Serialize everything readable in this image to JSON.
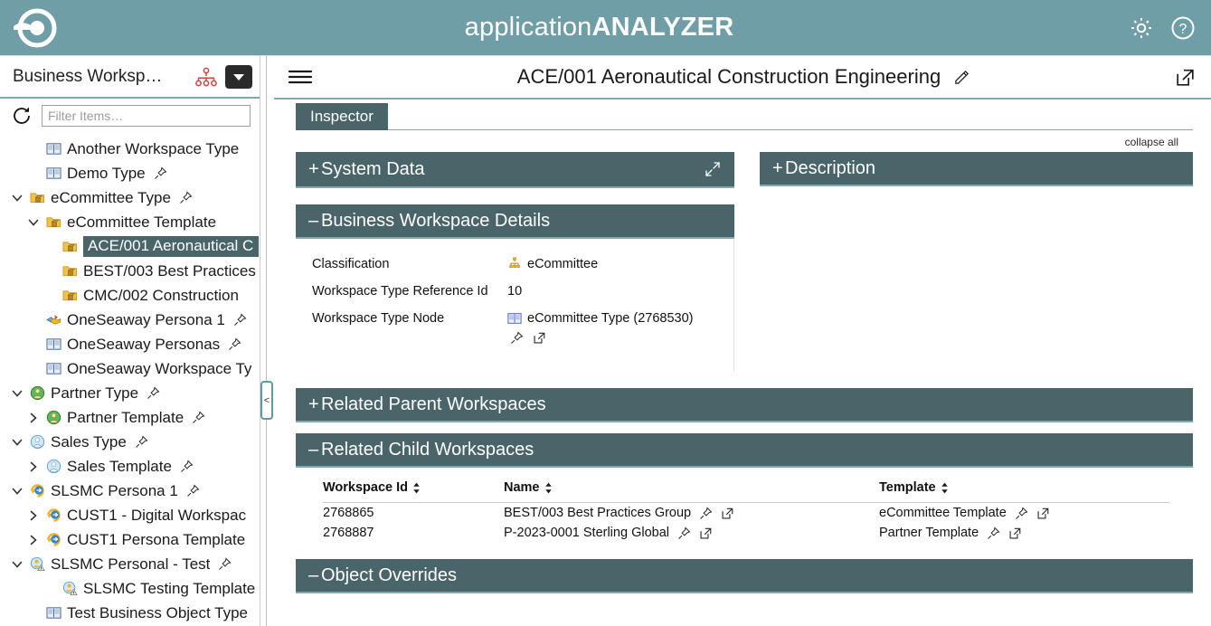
{
  "app": {
    "brand_light": "application",
    "brand_bold": "ANALYZER",
    "logo_icon": "target-ring-logo",
    "settings_icon": "gear-icon",
    "help_icon": "question-circle-icon"
  },
  "sidebar": {
    "title": "Business Worksp…",
    "hierarchy_icon": "org-chart-icon",
    "dropdown_icon": "chevron-down-icon",
    "refresh_icon": "refresh-icon",
    "filter_placeholder": "Filter Items…",
    "collapse_handle_label": "<",
    "tree": [
      {
        "label": "Another Workspace Type",
        "indent": 1,
        "twisty": "none",
        "icon": "book-type-icon",
        "pinned": false,
        "selected": false
      },
      {
        "label": "Demo Type",
        "indent": 1,
        "twisty": "none",
        "icon": "book-type-icon",
        "pinned": true,
        "selected": false
      },
      {
        "label": "eCommittee Type",
        "indent": 0,
        "twisty": "expanded",
        "icon": "folder-workspace-icon",
        "pinned": true,
        "selected": false
      },
      {
        "label": "eCommittee Template",
        "indent": 1,
        "twisty": "expanded",
        "icon": "folder-workspace-icon",
        "pinned": false,
        "selected": false
      },
      {
        "label": "ACE/001 Aeronautical C",
        "indent": 2,
        "twisty": "none",
        "icon": "folder-workspace-icon",
        "pinned": false,
        "selected": true
      },
      {
        "label": "BEST/003 Best Practices",
        "indent": 2,
        "twisty": "none",
        "icon": "folder-workspace-icon",
        "pinned": false,
        "selected": false
      },
      {
        "label": "CMC/002 Construction",
        "indent": 2,
        "twisty": "none",
        "icon": "folder-workspace-icon",
        "pinned": false,
        "selected": false
      },
      {
        "label": "OneSeaway Persona 1",
        "indent": 1,
        "twisty": "none",
        "icon": "persona-handshake-icon",
        "pinned": true,
        "selected": false
      },
      {
        "label": "OneSeaway Personas",
        "indent": 1,
        "twisty": "none",
        "icon": "book-type-icon",
        "pinned": true,
        "selected": false
      },
      {
        "label": "OneSeaway Workspace Ty",
        "indent": 1,
        "twisty": "none",
        "icon": "book-type-icon",
        "pinned": false,
        "selected": false
      },
      {
        "label": "Partner Type",
        "indent": 0,
        "twisty": "expanded",
        "icon": "person-green-icon",
        "pinned": true,
        "selected": false
      },
      {
        "label": "Partner Template",
        "indent": 1,
        "twisty": "collapsed",
        "icon": "person-green-icon",
        "pinned": true,
        "selected": false
      },
      {
        "label": "Sales Type",
        "indent": 0,
        "twisty": "expanded",
        "icon": "person-blue-icon",
        "pinned": true,
        "selected": false
      },
      {
        "label": "Sales Template",
        "indent": 1,
        "twisty": "collapsed",
        "icon": "person-blue-icon",
        "pinned": true,
        "selected": false
      },
      {
        "label": "SLSMC Persona 1",
        "indent": 0,
        "twisty": "expanded",
        "icon": "persona-arrow-icon",
        "pinned": true,
        "selected": false
      },
      {
        "label": "CUST1 - Digital Workspac",
        "indent": 1,
        "twisty": "collapsed",
        "icon": "persona-arrow-icon",
        "pinned": false,
        "selected": false
      },
      {
        "label": "CUST1 Persona Template",
        "indent": 1,
        "twisty": "collapsed",
        "icon": "persona-arrow-icon",
        "pinned": false,
        "selected": false
      },
      {
        "label": "SLSMC Personal - Test",
        "indent": 0,
        "twisty": "expanded",
        "icon": "persona-warn-icon",
        "pinned": true,
        "selected": false
      },
      {
        "label": "SLSMC Testing Template",
        "indent": 2,
        "twisty": "none",
        "icon": "persona-warn-icon",
        "pinned": false,
        "selected": false
      },
      {
        "label": "Test Business Object Type",
        "indent": 1,
        "twisty": "none",
        "icon": "book-type-icon",
        "pinned": false,
        "selected": false
      }
    ]
  },
  "main": {
    "menu_icon": "hamburger-menu-icon",
    "title": "ACE/001 Aeronautical Construction Engineering",
    "edit_icon": "edit-pencil-icon",
    "open_external_icon": "open-in-new-window-icon",
    "tabs": [
      {
        "label": "Inspector",
        "active": true
      }
    ],
    "collapse_all_label": "collapse all",
    "panels": {
      "system_data": {
        "toggle": "+",
        "title": "System Data",
        "expand_icon": "expand-diagonal-icon"
      },
      "description": {
        "toggle": "+",
        "title": "Description"
      },
      "business_workspace_details": {
        "toggle": "–",
        "title": "Business Workspace Details",
        "fields": [
          {
            "label": "Classification",
            "value": "eCommittee",
            "icon": "classification-icon",
            "actions": []
          },
          {
            "label": "Workspace Type Reference Id",
            "value": "10",
            "icon": "",
            "actions": []
          },
          {
            "label": "Workspace Type Node",
            "value": "eCommittee Type (2768530)",
            "icon": "book-type-icon",
            "actions": [
              "pin-icon",
              "open-external-icon"
            ]
          }
        ]
      },
      "related_parent_workspaces": {
        "toggle": "+",
        "title": "Related Parent Workspaces"
      },
      "related_child_workspaces": {
        "toggle": "–",
        "title": "Related Child Workspaces",
        "columns": [
          {
            "label": "Workspace Id",
            "sort_icon": "sort-updown-icon"
          },
          {
            "label": "Name",
            "sort_icon": "sort-updown-icon"
          },
          {
            "label": "Template",
            "sort_icon": "sort-updown-icon"
          }
        ],
        "rows": [
          {
            "workspace_id": "2768865",
            "name": "BEST/003 Best Practices Group",
            "name_actions": [
              "pin-icon",
              "open-external-icon"
            ],
            "template": "eCommittee Template",
            "template_actions": [
              "pin-icon",
              "open-external-icon"
            ]
          },
          {
            "workspace_id": "2768887",
            "name": "P-2023-0001 Sterling Global",
            "name_actions": [
              "pin-icon",
              "open-external-icon"
            ],
            "template": "Partner Template",
            "template_actions": [
              "pin-icon",
              "open-external-icon"
            ]
          }
        ]
      },
      "object_overrides": {
        "toggle": "–",
        "title": "Object Overrides"
      }
    }
  },
  "colors": {
    "topbar": "#6f9ea6",
    "panel_header": "#4a6569",
    "accent_line": "#7fa9b0",
    "selection": "#4a6569"
  }
}
